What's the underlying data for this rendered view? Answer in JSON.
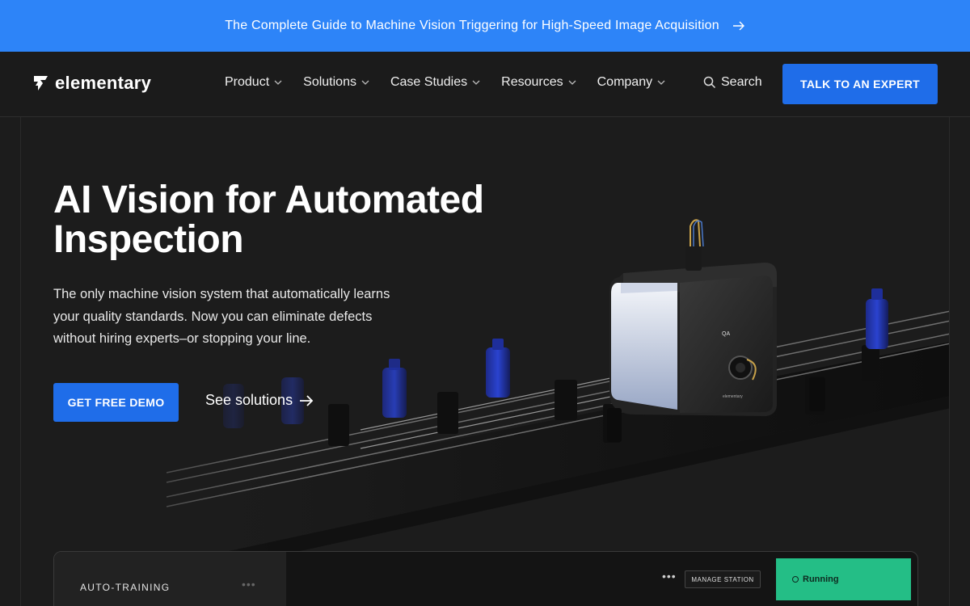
{
  "announcement": {
    "text": "The Complete Guide to Machine Vision Triggering for High-Speed Image Acquisition",
    "arrow_icon": "arrow-right-icon"
  },
  "brand": {
    "name": "elementary",
    "logo_icon": "elementary-logo-icon"
  },
  "nav": {
    "items": [
      {
        "label": "Product"
      },
      {
        "label": "Solutions"
      },
      {
        "label": "Case Studies"
      },
      {
        "label": "Resources"
      },
      {
        "label": "Company"
      }
    ],
    "search_label": "Search",
    "cta_label": "TALK TO AN EXPERT"
  },
  "hero": {
    "title": "AI Vision for Automated Inspection",
    "subtitle": "The only machine vision system that automatically learns your quality standards. Now you can eliminate defects without hiring experts–or stopping your line.",
    "primary_button": "GET FREE DEMO",
    "secondary_link": "See solutions",
    "illustration": {
      "device_label": "QA",
      "device_brand": "elementary"
    }
  },
  "dashboard": {
    "left_label": "AUTO-TRAINING",
    "left_menu_icon": "•••",
    "mid_menu_icon": "•••",
    "manage_button": "MANAGE STATION",
    "status": "Running"
  },
  "colors": {
    "accent": "#1f6de9",
    "announce_bg": "#2d84f8",
    "page_bg": "#1c1c1c",
    "status_green": "#24be86"
  }
}
